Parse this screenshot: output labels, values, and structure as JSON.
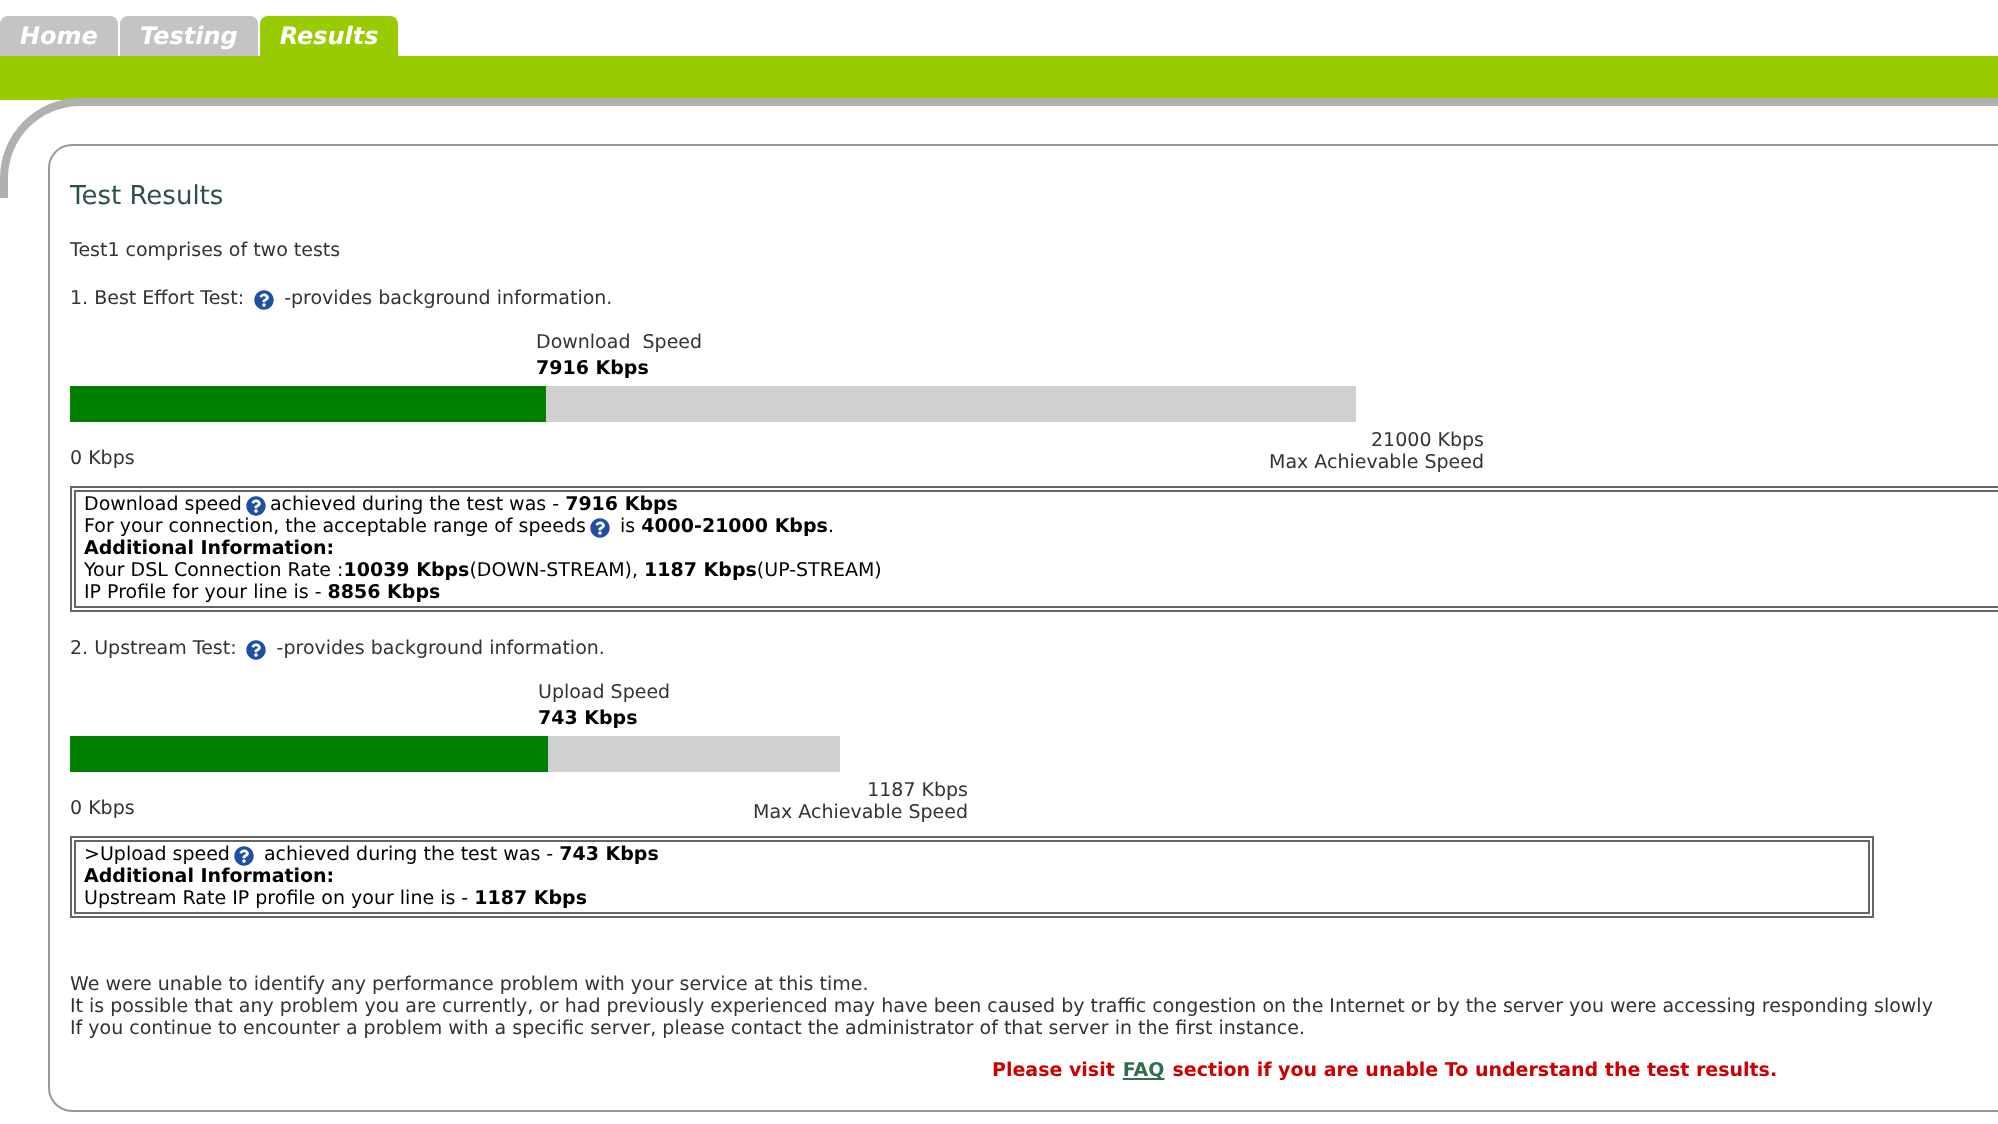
{
  "tabs": [
    {
      "label": "Home",
      "selected": false
    },
    {
      "label": "Testing",
      "selected": false
    },
    {
      "label": "Results",
      "selected": true
    }
  ],
  "title": "Test Results",
  "intro": "Test1 comprises of two tests",
  "tests": [
    {
      "heading": "1. Best Effort Test:",
      "heading_note": "-provides background information.",
      "meter_label": "Download  Speed",
      "meter_value": "7916 Kbps",
      "level": 0.37,
      "min_label": "0 Kbps",
      "max_value": "21000 Kbps",
      "max_label": "Max Achievable Speed",
      "info": [
        {
          "before": "Download speed",
          "after": "achieved during the test was - **7916 Kbps**"
        },
        {
          "before": "For your connection, the acceptable range of speeds",
          "after": " is **4000-21000 Kbps**."
        },
        {
          "before": "**Additional Information:**"
        },
        {
          "before": "Your DSL Connection Rate :**10039 Kbps**(DOWN-STREAM), **1187 Kbps**(UP-STREAM)"
        },
        {
          "before": "IP Profile for your line is - **8856 Kbps**"
        }
      ]
    },
    {
      "heading": "2. Upstream Test:",
      "heading_note": "-provides background information.",
      "meter_label": "Upload Speed",
      "meter_value": "743 Kbps",
      "level": 0.62,
      "min_label": "0 Kbps",
      "max_value": "1187 Kbps",
      "max_label": "Max Achievable Speed",
      "info": [
        {
          "before": ">Upload speed",
          "after": " achieved during the test was - **743 Kbps**"
        },
        {
          "before": "**Additional Information:**"
        },
        {
          "before": "Upstream Rate IP profile on your line is - **1187 Kbps**"
        }
      ]
    }
  ],
  "notes": [
    "We were unable to identify any performance problem with your service at this time.",
    "It is possible that any problem you are currently, or had previously experienced may have been caused by traffic congestion on the Internet or by the server you were accessing responding slowly",
    "If you continue to encounter a problem with a specific server, please contact the administrator of that server in the first instance."
  ],
  "faq": {
    "before": "Please visit",
    "link": "FAQ",
    "after": "section if you are unable To understand the test results."
  }
}
